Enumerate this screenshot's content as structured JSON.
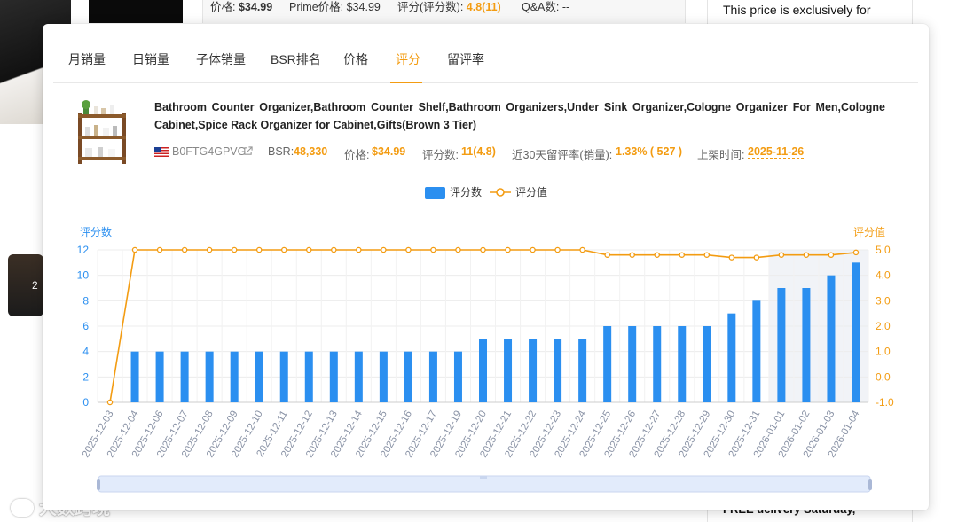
{
  "background": {
    "top_strip": {
      "price_label": "价格:",
      "price_value": "$34.99",
      "prime_label": "Prime价格:",
      "prime_value": "$34.99",
      "rating_label": "评分(评分数):",
      "rating_value": "4.8(11)",
      "qa_label": "Q&A数:",
      "qa_value": "--"
    },
    "right_top_text": "This price is exclusively for",
    "right_bottom_text": "FREE delivery Saturday,",
    "thumb_text": "2",
    "watermark": "大数跨境",
    "bottom_fragment": "··· ·"
  },
  "tabs": [
    {
      "label": "月销量",
      "active": false
    },
    {
      "label": "日销量",
      "active": false
    },
    {
      "label": "子体销量",
      "active": false
    },
    {
      "label": "BSR排名",
      "active": false
    },
    {
      "label": "价格",
      "active": false
    },
    {
      "label": "评分",
      "active": true
    },
    {
      "label": "留评率",
      "active": false
    }
  ],
  "product": {
    "title": "Bathroom Counter Organizer,Bathroom Counter Shelf,Bathroom Organizers,Under Sink Organizer,Cologne Organizer For Men,Cologne Cabinet,Spice Rack Organizer for Cabinet,Gifts(Brown 3 Tier)",
    "asin": "B0FTG4GPVG",
    "bsr_label": "BSR:",
    "bsr_value": "48,330",
    "price_label": "价格:",
    "price_value": "$34.99",
    "rating_count_label": "评分数:",
    "rating_count_value": "11(4.8)",
    "review_rate_label": "近30天留评率(销量):",
    "review_rate_value": "1.33% ( 527 )",
    "listed_label": "上架时间:",
    "listed_value": "2025-11-26"
  },
  "colors": {
    "accent": "#f39c12",
    "bar": "#2b8ff0",
    "line": "#f39c12",
    "left_axis": "#2b8ff0",
    "right_axis": "#f39c12"
  },
  "chart_data": {
    "type": "bar",
    "legend": [
      "评分数",
      "评分值"
    ],
    "legend_position": "top-center",
    "ylabel_left": "评分数",
    "ylabel_right": "评分值",
    "ylim_left": [
      0,
      12
    ],
    "yticks_left": [
      "0",
      "2",
      "4",
      "6",
      "8",
      "10",
      "12"
    ],
    "ylim_right": [
      -1.0,
      5.0
    ],
    "yticks_right": [
      "-1.0",
      "0.0",
      "1.0",
      "2.0",
      "3.0",
      "4.0",
      "5.0"
    ],
    "grid": true,
    "categories": [
      "2025-12-03",
      "2025-12-04",
      "2025-12-06",
      "2025-12-07",
      "2025-12-08",
      "2025-12-09",
      "2025-12-10",
      "2025-12-11",
      "2025-12-12",
      "2025-12-13",
      "2025-12-14",
      "2025-12-15",
      "2025-12-16",
      "2025-12-17",
      "2025-12-19",
      "2025-12-20",
      "2025-12-21",
      "2025-12-22",
      "2025-12-23",
      "2025-12-24",
      "2025-12-25",
      "2025-12-26",
      "2025-12-27",
      "2025-12-28",
      "2025-12-29",
      "2025-12-30",
      "2025-12-31",
      "2026-01-01",
      "2026-01-02",
      "2026-01-03",
      "2026-01-04"
    ],
    "series": [
      {
        "name": "评分数",
        "type": "bar",
        "axis": "left",
        "values": [
          0,
          4,
          4,
          4,
          4,
          4,
          4,
          4,
          4,
          4,
          4,
          4,
          4,
          4,
          4,
          5,
          5,
          5,
          5,
          5,
          6,
          6,
          6,
          6,
          6,
          7,
          8,
          9,
          9,
          10,
          11
        ]
      },
      {
        "name": "评分值",
        "type": "line",
        "axis": "right",
        "values": [
          -1.0,
          5.0,
          5.0,
          5.0,
          5.0,
          5.0,
          5.0,
          5.0,
          5.0,
          5.0,
          5.0,
          5.0,
          5.0,
          5.0,
          5.0,
          5.0,
          5.0,
          5.0,
          5.0,
          5.0,
          4.8,
          4.8,
          4.8,
          4.8,
          4.8,
          4.7,
          4.7,
          4.8,
          4.8,
          4.8,
          4.9
        ]
      }
    ],
    "highlight_range_from": "2026-01-01"
  }
}
